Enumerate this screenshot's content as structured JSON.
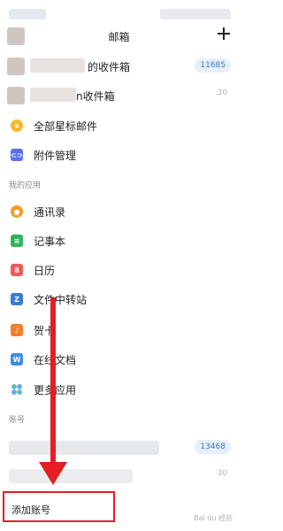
{
  "header": {
    "title": "邮箱"
  },
  "accounts": [
    {
      "label": "的收件箱",
      "count": "11685",
      "highlight": true
    },
    {
      "label": "n收件箱",
      "count": "30",
      "highlight": false
    }
  ],
  "quick_items": [
    {
      "label": "全部星标邮件",
      "icon": "star-icon",
      "color": "#f5b82e"
    },
    {
      "label": "附件管理",
      "icon": "attachment-icon",
      "color": "#5a6ff0"
    }
  ],
  "apps_section": {
    "title": "我的应用",
    "items": [
      {
        "label": "通讯录",
        "icon": "contacts-icon",
        "color": "#f39c28"
      },
      {
        "label": "记事本",
        "icon": "notes-icon",
        "color": "#34b25b"
      },
      {
        "label": "日历",
        "icon": "calendar-icon",
        "color": "#ec5b5b",
        "glyph": "8"
      },
      {
        "label": "文件中转站",
        "icon": "file-transfer-icon",
        "color": "#3a7bd5",
        "glyph": "Z"
      },
      {
        "label": "贺卡",
        "icon": "greeting-card-icon",
        "color": "#f07f2a",
        "glyph": "♪"
      },
      {
        "label": "在线文档",
        "icon": "online-docs-icon",
        "color": "#3d8de6",
        "glyph": "W"
      },
      {
        "label": "更多应用",
        "icon": "more-apps-icon",
        "color": "#5cbfb3"
      }
    ]
  },
  "account_section": {
    "title": "账号",
    "accounts": [
      {
        "count": "13468",
        "highlight": true
      },
      {
        "count": "30",
        "highlight": false
      }
    ],
    "add_account_label": "添加账号"
  },
  "watermark": "Bai du 经验"
}
